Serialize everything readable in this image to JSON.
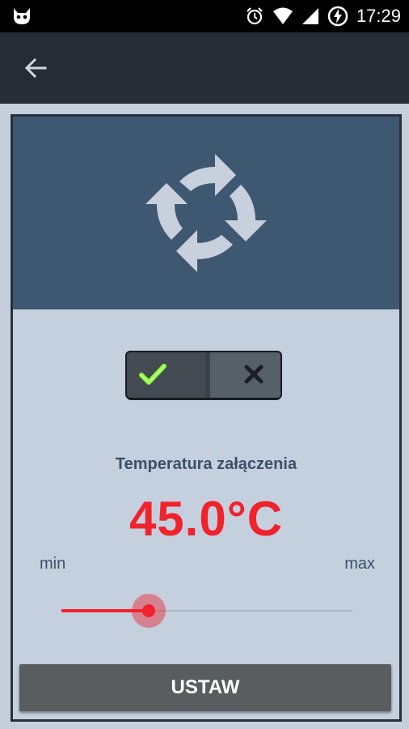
{
  "status_bar": {
    "time": "17:29"
  },
  "app_bar": {
    "back_icon": "arrow-left-icon"
  },
  "hero": {
    "icon": "circular-arrows-refresh-icon"
  },
  "toggle": {
    "on_icon": "checkmark-icon",
    "off_icon": "x-icon",
    "state": "on",
    "on_color": "#7dff2e"
  },
  "temperature": {
    "label": "Temperatura załączenia",
    "value": "45.0°C",
    "color": "#f0222c"
  },
  "slider": {
    "min_label": "min",
    "max_label": "max",
    "level_fraction": 0.3
  },
  "button": {
    "label": "USTAW"
  }
}
